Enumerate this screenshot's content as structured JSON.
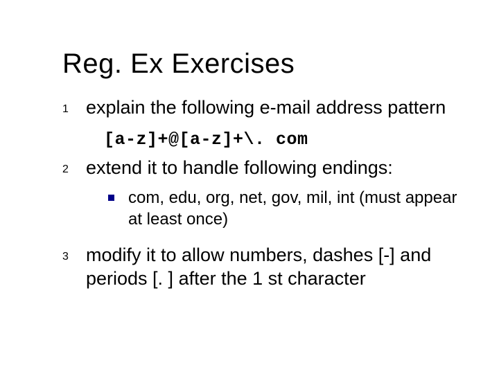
{
  "title": "Reg. Ex Exercises",
  "items": [
    {
      "num": "1",
      "text": "explain the following e-mail address pattern"
    },
    {
      "num": "2",
      "text": "extend it to handle following endings:"
    },
    {
      "num": "3",
      "text": "modify it to allow numbers, dashes [-] and periods [. ] after the 1 st character"
    }
  ],
  "code": "[a-z]+@[a-z]+\\. com",
  "sub_bullet": "com, edu, org, net, gov, mil, int (must appear at least once)"
}
